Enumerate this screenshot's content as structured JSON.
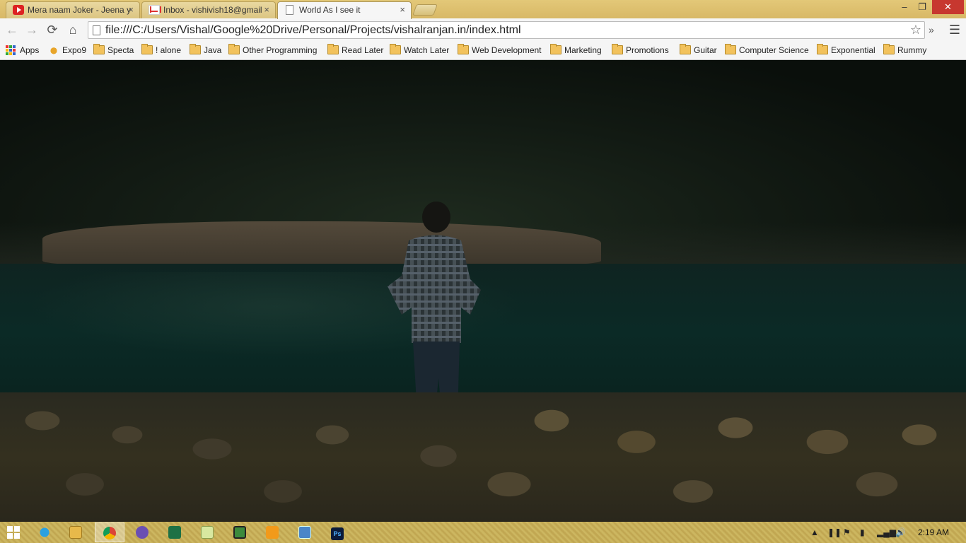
{
  "browser": {
    "tabs": [
      {
        "title": "Mera naam Joker - Jeena y",
        "favicon": "youtube-icon",
        "active": false
      },
      {
        "title": "Inbox - vishivish18@gmail",
        "favicon": "gmail-icon",
        "active": false
      },
      {
        "title": "World As I see it",
        "favicon": "page-icon",
        "active": true
      }
    ],
    "tab_close": "×",
    "window_controls": {
      "minimize": "–",
      "maximize": "❐",
      "close": "✕"
    },
    "nav": {
      "back": "←",
      "forward": "→",
      "reload": "⟳",
      "home": "⌂"
    },
    "url": "file:///C:/Users/Vishal/Google%20Drive/Personal/Projects/vishalranjan.in/index.html",
    "bookmark_star": "☆",
    "overflow": "»",
    "menu": "☰"
  },
  "bookmarks": [
    {
      "label": "Apps",
      "icon": "apps-grid-icon"
    },
    {
      "label": "Expo9",
      "icon": "expo9-icon"
    },
    {
      "label": "Specta",
      "icon": "folder-icon"
    },
    {
      "label": "! alone",
      "icon": "folder-icon"
    },
    {
      "label": "Java",
      "icon": "folder-icon"
    },
    {
      "label": "Other Programming",
      "icon": "folder-icon"
    },
    {
      "label": "Read Later",
      "icon": "folder-icon"
    },
    {
      "label": "Watch Later",
      "icon": "folder-icon"
    },
    {
      "label": "Web Development",
      "icon": "folder-icon"
    },
    {
      "label": "Marketing",
      "icon": "folder-icon"
    },
    {
      "label": "Promotions",
      "icon": "folder-icon"
    },
    {
      "label": "Guitar",
      "icon": "folder-icon"
    },
    {
      "label": "Computer Science",
      "icon": "folder-icon"
    },
    {
      "label": "Exponential",
      "icon": "folder-icon"
    },
    {
      "label": "Rummy",
      "icon": "folder-icon"
    }
  ],
  "content": {
    "image": "dark-riverside-photo"
  },
  "taskbar": {
    "apps": [
      {
        "name": "internet-explorer-icon",
        "active": false
      },
      {
        "name": "file-explorer-icon",
        "active": false
      },
      {
        "name": "chrome-icon",
        "active": true
      },
      {
        "name": "app-purple-icon",
        "active": false
      },
      {
        "name": "excel-icon",
        "active": false
      },
      {
        "name": "sticky-notes-icon",
        "active": false
      },
      {
        "name": "app-green-icon",
        "active": false
      },
      {
        "name": "media-player-icon",
        "active": false
      },
      {
        "name": "remote-desktop-icon",
        "active": false
      },
      {
        "name": "photoshop-icon",
        "active": false
      }
    ],
    "photoshop_label": "Ps",
    "tray": {
      "show_hidden": "▲",
      "clock": "2:19 AM"
    }
  },
  "colors": {
    "chrome_frame": "#dcc170",
    "toolbar": "#f5f5f5",
    "close_button": "#c7372f",
    "taskbar": "#c1a64e"
  }
}
